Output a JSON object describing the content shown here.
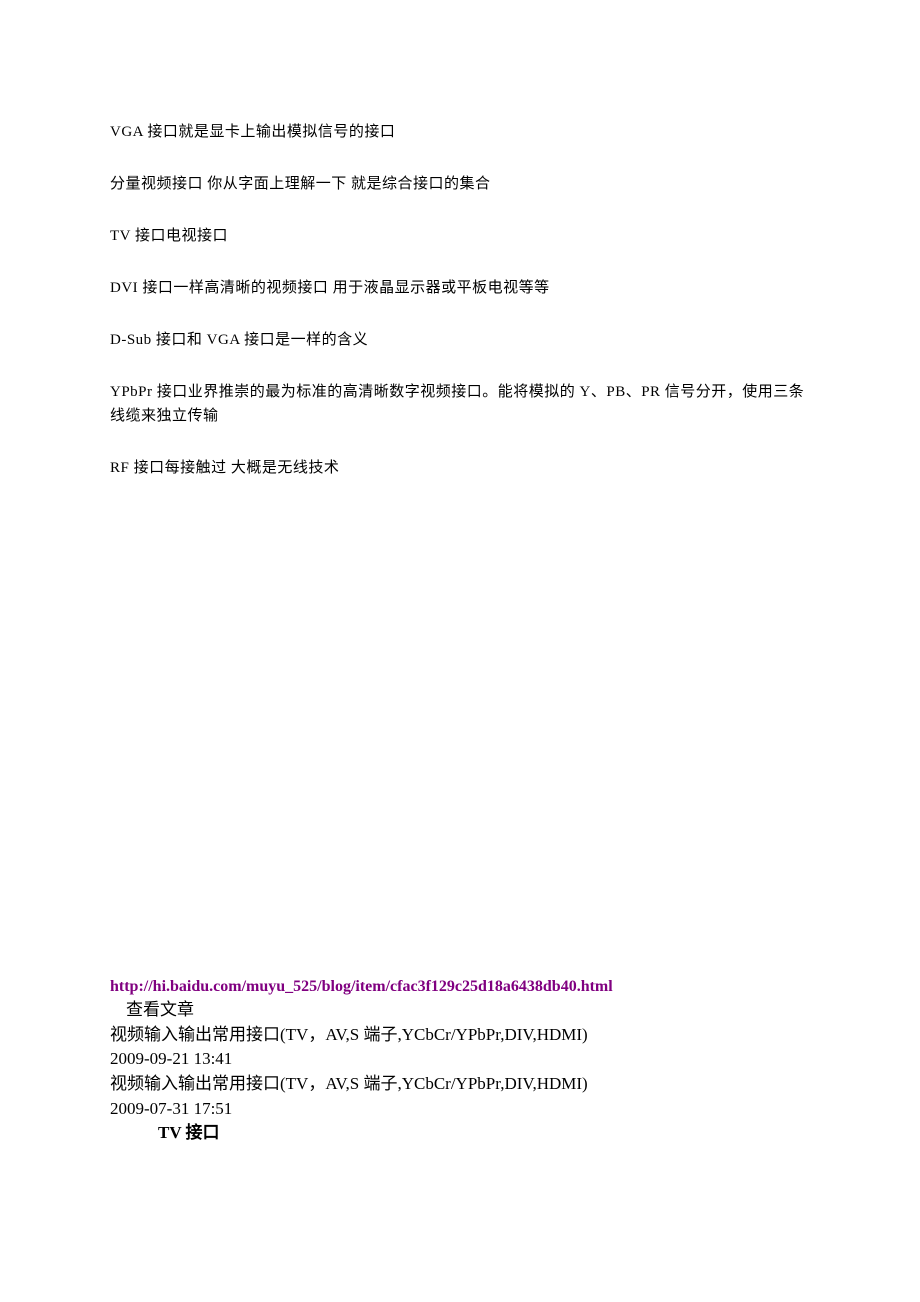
{
  "paragraphs": {
    "p1": "VGA 接口就是显卡上输出模拟信号的接口",
    "p2": "分量视频接口 你从字面上理解一下 就是综合接口的集合",
    "p3": "TV 接口电视接口",
    "p4": "DVI 接口一样高清晰的视频接口 用于液晶显示器或平板电视等等",
    "p5": "D-Sub 接口和 VGA 接口是一样的含义",
    "p6": "YPbPr 接口业界推崇的最为标准的高清晰数字视频接口。能将模拟的 Y、PB、PR 信号分开，使用三条线缆来独立传输",
    "p7": "RF 接口每接触过 大概是无线技术"
  },
  "link_text": "http://hi.baidu.com/muyu_525/blog/item/cfac3f129c25d18a6438db40.html",
  "footer": {
    "view_article": "查看文章",
    "title1": "视频输入输出常用接口(TV，AV,S 端子,YCbCr/YPbPr,DIV,HDMI)",
    "date1": "2009-09-21 13:41",
    "title2": "视频输入输出常用接口(TV，AV,S 端子,YCbCr/YPbPr,DIV,HDMI)",
    "date2": "2009-07-31 17:51",
    "section": "TV 接口"
  }
}
